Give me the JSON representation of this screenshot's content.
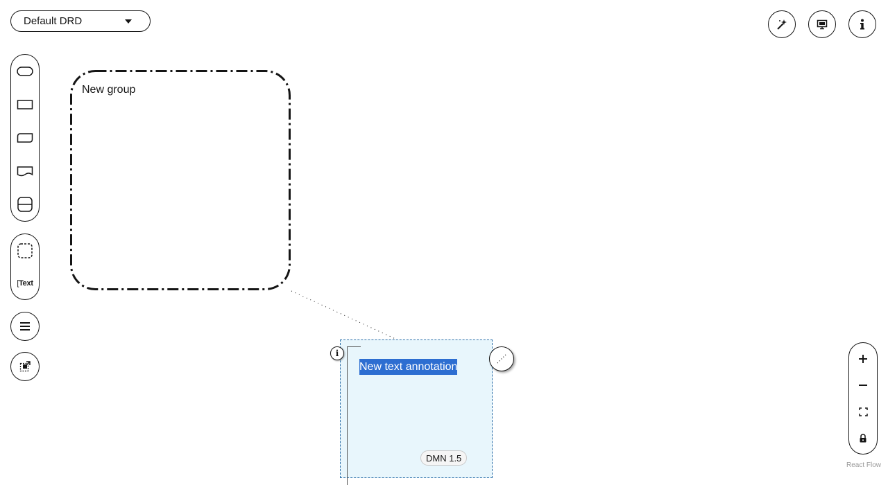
{
  "drd_selector": {
    "value": "Default DRD"
  },
  "toolbar_right": {
    "items": [
      {
        "icon": "magic-wand-icon"
      },
      {
        "icon": "overlays-icon"
      },
      {
        "icon": "info-icon"
      }
    ]
  },
  "palette": {
    "nodes": [
      "decision-shape-icon",
      "input-data-shape-icon",
      "bkm-shape-icon",
      "knowledge-source-shape-icon",
      "decision-service-shape-icon"
    ],
    "annotations": {
      "group_icon": "group-shape-icon",
      "text_label": "Text"
    },
    "extra": [
      "hamburger-menu-icon",
      "external-link-icon"
    ]
  },
  "canvas": {
    "group": {
      "label": "New group"
    },
    "text_annotation": {
      "text": "New text annotation"
    },
    "version_badge": "DMN 1.5"
  },
  "zoom_controls": [
    "zoom-in-icon",
    "zoom-out-icon",
    "fit-view-icon",
    "lock-icon"
  ],
  "attribution": "React Flow",
  "colors": {
    "selection_fill": "#e8f6fc",
    "selection_border": "#2b6ea8",
    "text_highlight": "#2d6ed1"
  }
}
